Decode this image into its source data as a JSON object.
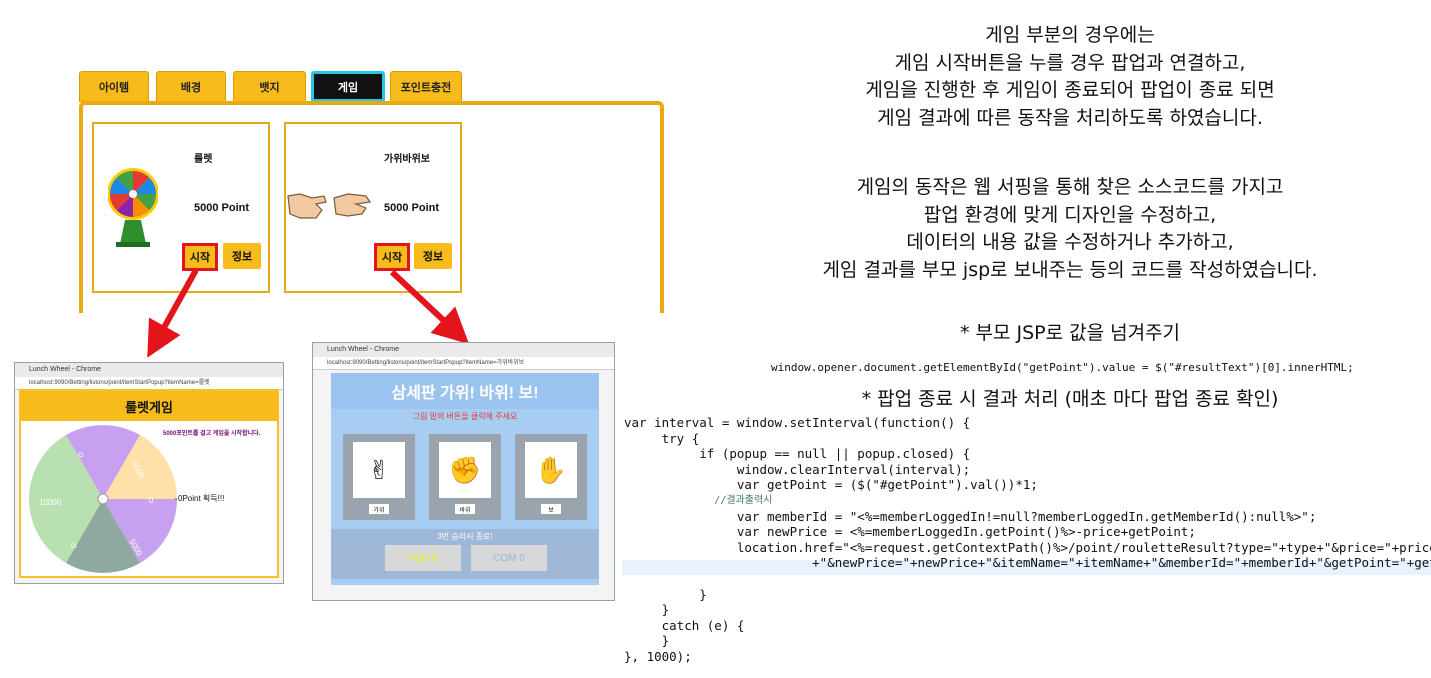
{
  "tabs": [
    {
      "label": "아이템",
      "active": false
    },
    {
      "label": "배경",
      "active": false
    },
    {
      "label": "뱃지",
      "active": false
    },
    {
      "label": "게임",
      "active": true
    },
    {
      "label": "포인트충전",
      "active": false
    }
  ],
  "cards": [
    {
      "title": "룰렛",
      "price": "5000 Point",
      "start_label": "시작",
      "info_label": "정보",
      "icon": "roulette-wheel-icon"
    },
    {
      "title": "가위바위보",
      "price": "5000 Point",
      "start_label": "시작",
      "info_label": "정보",
      "icon": "rock-paper-scissors-icon"
    }
  ],
  "roulette_popup": {
    "window_title": "Lunch Wheel - Chrome",
    "url": "localhost:9090/Betting/listons/point/itemStartPopup?itemName=룰렛",
    "heading": "룰렛게임",
    "notice": "5000포인트를 걸고 게임을 시작합니다.",
    "segments": [
      "0",
      "5000",
      "0",
      "5000",
      "10000",
      "0"
    ],
    "result_text": "0Point 획득!!!"
  },
  "rps_popup": {
    "window_title": "Lunch Wheel - Chrome",
    "url": "localhost:9090/Betting/listons/point/itemStartPopup?itemName=가위바위보",
    "heading": "삼세판 가위! 바위! 보!",
    "instruction": "그림 밑의 버튼을 클릭해 주세요",
    "choices": [
      "가위",
      "바위",
      "보"
    ],
    "win_rule": "3번 승리시 종료!",
    "you_score": "YOU 0",
    "com_score": "COM 0"
  },
  "description": {
    "para1": [
      "게임 부분의 경우에는",
      "게임 시작버튼을 누를 경우 팝업과 연결하고,",
      "게임을 진행한 후 게임이 종료되어 팝업이 종료 되면",
      "게임 결과에 따른 동작을 처리하도록 하였습니다."
    ],
    "para2": [
      "게임의 동작은 웹 서핑을 통해 찾은 소스코드를 가지고",
      "팝업 환경에 맞게 디자인을 수정하고,",
      "데이터의 내용 값을 수정하거나 추가하고,",
      "게임 결과를 부모 jsp로 보내주는 등의 코드를 작성하였습니다."
    ],
    "heading_parent": "* 부모 JSP로 값을 넘겨주기",
    "code_parent": "window.opener.document.getElementById(\"getPoint\").value = $(\"#resultText\")[0].innerHTML;",
    "heading_popup": "* 팝업 종료 시 결과 처리 (매초 마다 팝업 종료 확인)"
  },
  "code_lines": [
    "var interval = window.setInterval(function() {",
    "     try {",
    "          if (popup == null || popup.closed) {",
    "               window.clearInterval(interval);",
    "               var getPoint = ($(\"#getPoint\").val())*1;",
    "               //결과출력시",
    "               var memberId = \"<%=memberLoggedIn!=null?memberLoggedIn.getMemberId():null%>\";",
    "               var newPrice = <%=memberLoggedIn.getPoint()%>-price+getPoint;",
    "               location.href=\"<%=request.getContextPath()%>/point/rouletteResult?type=\"+type+\"&price=\"+price",
    "                         +\"&newPrice=\"+newPrice+\"&itemName=\"+itemName+\"&memberId=\"+memberId+\"&getPoint=\"+getPoint",
    "",
    "          }",
    "     }",
    "     catch (e) {",
    "     }",
    "}, 1000);"
  ],
  "colors": {
    "tab": "#f7bb1c",
    "accent_red": "#e3141b",
    "active_tab_border": "#22c8e6",
    "panel_border": "#e7aa12"
  }
}
